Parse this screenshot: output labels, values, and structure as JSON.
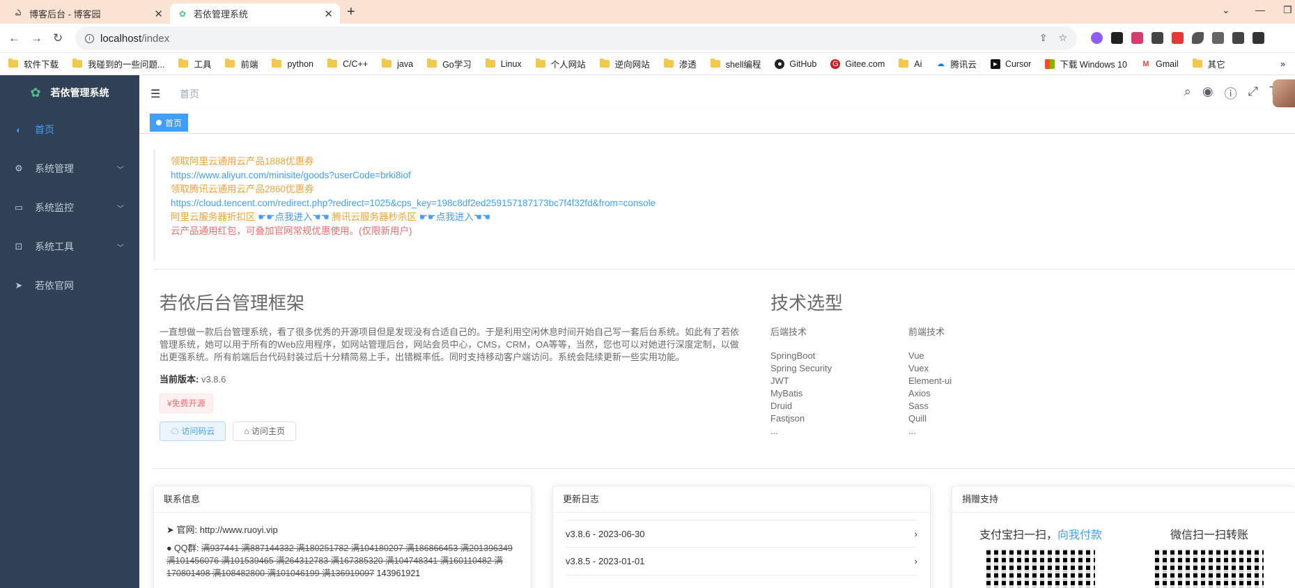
{
  "browser": {
    "tabs": [
      {
        "title": "博客后台 - 博客园",
        "active": false
      },
      {
        "title": "若依管理系统",
        "active": true
      }
    ],
    "url_host": "localhost",
    "url_path": "/index",
    "bookmarks": [
      "软件下载",
      "我碰到的一些问题...",
      "工具",
      "前端",
      "python",
      "C/C++",
      "java",
      "Go学习",
      "Linux",
      "个人网站",
      "逆向网站",
      "渗透",
      "shell编程",
      "GitHub",
      "Gitee.com",
      "Ai",
      "腾讯云",
      "Cursor",
      "下载 Windows 10",
      "Gmail",
      "其它"
    ]
  },
  "sidebar": {
    "title": "若依管理系统",
    "items": [
      {
        "label": "首页",
        "icon": "dashboard-icon",
        "active": true,
        "submenu": false
      },
      {
        "label": "系统管理",
        "icon": "gear-icon",
        "active": false,
        "submenu": true
      },
      {
        "label": "系统监控",
        "icon": "monitor-icon",
        "active": false,
        "submenu": true
      },
      {
        "label": "系统工具",
        "icon": "toolbox-icon",
        "active": false,
        "submenu": true
      },
      {
        "label": "若依官网",
        "icon": "paper-plane-icon",
        "active": false,
        "submenu": false
      }
    ]
  },
  "navbar": {
    "breadcrumb": "首页",
    "tag": "首页"
  },
  "promo": {
    "line1": "领取阿里云通用云产品1888优惠券",
    "link1": "https://www.aliyun.com/minisite/goods?userCode=brki8iof",
    "line2": "领取腾讯云通用云产品2860优惠券",
    "link2": "https://cloud.tencent.com/redirect.php?redirect=1025&cps_key=198c8df2ed259157187173bc7f4f32fd&from=console",
    "line3a": "阿里云服务器折扣区",
    "line3b": "☛☛点我进入☚☚",
    "line3c": "腾讯云服务器秒杀区",
    "line3d": "☛☛点我进入☚☚",
    "line4": "云产品通用红包，可叠加官网常规优惠使用。(仅限新用户)"
  },
  "intro": {
    "title": "若依后台管理框架",
    "desc": "一直想做一款后台管理系统，看了很多优秀的开源项目但是发现没有合适自己的。于是利用空闲休息时间开始自己写一套后台系统。如此有了若依管理系统，她可以用于所有的Web应用程序，如网站管理后台，网站会员中心，CMS，CRM，OA等等，当然，您也可以对她进行深度定制，以做出更强系统。所有前端后台代码封装过后十分精简易上手，出错概率低。同时支持移动客户端访问。系统会陆续更新一些实用功能。",
    "version_label": "当前版本:",
    "version": "v3.8.6",
    "free_tag": "¥免费开源",
    "btn_cloud": "访问码云",
    "btn_home": "访问主页"
  },
  "tech": {
    "title": "技术选型",
    "backend_head": "后端技术",
    "backend": [
      "SpringBoot",
      "Spring Security",
      "JWT",
      "MyBatis",
      "Druid",
      "Fastjson",
      "..."
    ],
    "frontend_head": "前端技术",
    "frontend": [
      "Vue",
      "Vuex",
      "Element-ui",
      "Axios",
      "Sass",
      "Quill",
      "..."
    ]
  },
  "contact": {
    "head": "联系信息",
    "site_label": "官网:",
    "site": "http://www.ruoyi.vip",
    "qq_label": "QQ群:",
    "qq_struck": "满937441 满887144332 满180251782 满104180207 满186866453 满201396349 满101456076 满101539465 满264312783 满167385320 满104748341 满160110482 满170801498 满108482800 满101046199 满136919097",
    "qq_open": "143961921"
  },
  "changelog": {
    "head": "更新日志",
    "entries": [
      "v3.8.6 - 2023-06-30",
      "v3.8.5 - 2023-01-01"
    ]
  },
  "donate": {
    "head": "捐赠支持",
    "alipay_prefix": "支付宝扫一扫，",
    "alipay_link": "向我付款",
    "wechat": "微信扫一扫转账"
  },
  "colors": {
    "sidebar": "#304156",
    "accent": "#409eff",
    "promo_orange": "#f4a336",
    "promo_red": "#f56c6c"
  }
}
